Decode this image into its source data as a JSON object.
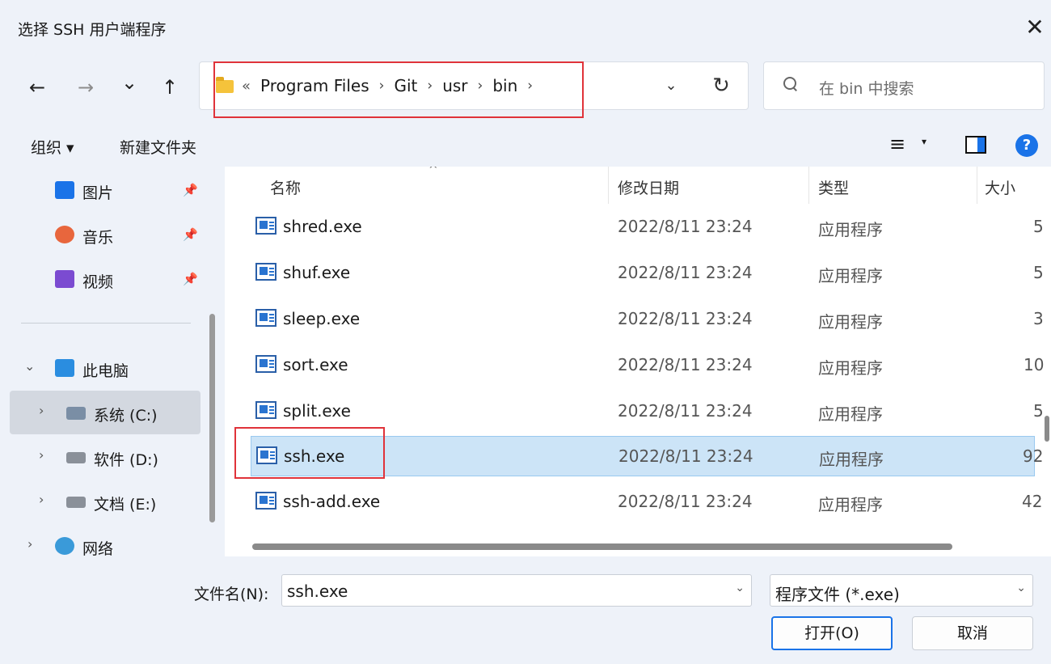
{
  "window": {
    "title": "选择 SSH 用户端程序",
    "close_glyph": "✕"
  },
  "nav": {
    "back_glyph": "←",
    "forward_glyph": "→",
    "recent_glyph": "⌄",
    "up_glyph": "↑",
    "breadcrumb_more": "«",
    "breadcrumbs": [
      "Program Files",
      "Git",
      "usr",
      "bin"
    ],
    "crumb_sep": "›",
    "dropdown_glyph": "⌄",
    "refresh_glyph": "↻",
    "search_placeholder": "在 bin 中搜索"
  },
  "toolbar": {
    "organize_label": "组织 ▾",
    "new_folder_label": "新建文件夹",
    "view_glyph": "≡",
    "view_caret": "▾",
    "help_glyph": "?"
  },
  "sidebar": {
    "quick_access": [
      {
        "label": "图片",
        "icon": "pictures-icon",
        "color": "#1a73e8",
        "pin": "📌"
      },
      {
        "label": "音乐",
        "icon": "music-icon",
        "color": "#e8663d",
        "pin": "📌"
      },
      {
        "label": "视频",
        "icon": "video-icon",
        "color": "#7b4bd1",
        "pin": "📌"
      }
    ],
    "this_pc": {
      "label": "此电脑",
      "chevron": "⌄"
    },
    "drives": [
      {
        "label": "系统 (C:)",
        "chevron": "›",
        "selected": true
      },
      {
        "label": "软件 (D:)",
        "chevron": "›",
        "selected": false
      },
      {
        "label": "文档 (E:)",
        "chevron": "›",
        "selected": false
      }
    ],
    "network": {
      "label": "网络",
      "chevron": "›"
    }
  },
  "files": {
    "columns": {
      "name": "名称",
      "modified": "修改日期",
      "type": "类型",
      "size": "大小"
    },
    "sort_indicator": "^",
    "rows": [
      {
        "name": "shred.exe",
        "modified": "2022/8/11 23:24",
        "type": "应用程序",
        "size": "5",
        "selected": false
      },
      {
        "name": "shuf.exe",
        "modified": "2022/8/11 23:24",
        "type": "应用程序",
        "size": "5",
        "selected": false
      },
      {
        "name": "sleep.exe",
        "modified": "2022/8/11 23:24",
        "type": "应用程序",
        "size": "3",
        "selected": false
      },
      {
        "name": "sort.exe",
        "modified": "2022/8/11 23:24",
        "type": "应用程序",
        "size": "10",
        "selected": false
      },
      {
        "name": "split.exe",
        "modified": "2022/8/11 23:24",
        "type": "应用程序",
        "size": "5",
        "selected": false
      },
      {
        "name": "ssh.exe",
        "modified": "2022/8/11 23:24",
        "type": "应用程序",
        "size": "92",
        "selected": true
      },
      {
        "name": "ssh-add.exe",
        "modified": "2022/8/11 23:24",
        "type": "应用程序",
        "size": "42",
        "selected": false
      }
    ]
  },
  "footer": {
    "filename_label": "文件名(N):",
    "filename_value": "ssh.exe",
    "dropdown_glyph": "⌄",
    "filter_value": "程序文件 (*.exe)",
    "open_label": "打开(O)",
    "cancel_label": "取消"
  },
  "colors": {
    "accent": "#1a73e8",
    "selected_row": "#cce4f7",
    "annotation_red": "#e0333a",
    "chrome_bg": "#eef2f9"
  }
}
